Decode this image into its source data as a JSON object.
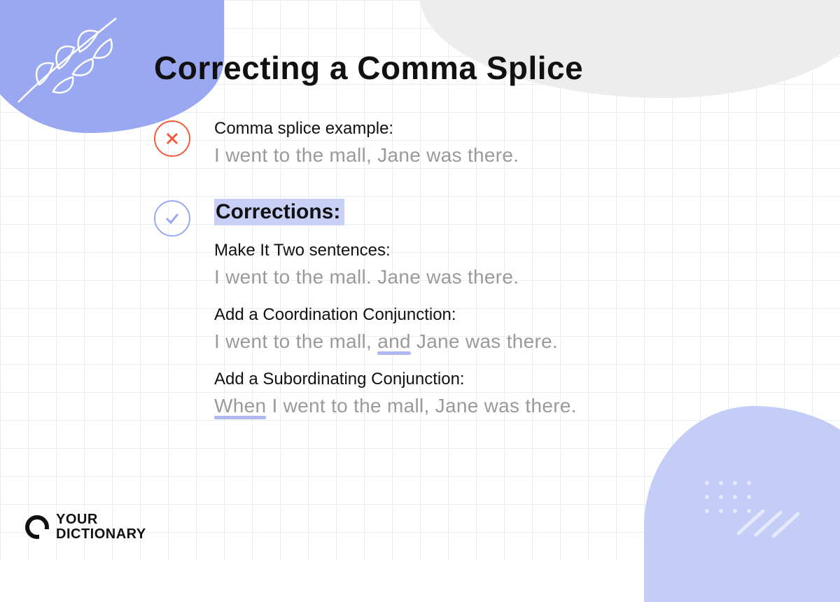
{
  "title": "Correcting a Comma Splice",
  "wrong": {
    "label": "Comma splice example:",
    "example": "I went to the mall, Jane was there."
  },
  "correctionsHeading": "Corrections:",
  "corrections": [
    {
      "label": "Make It Two sentences:",
      "example": "I went to the mall. Jane was there."
    },
    {
      "label": "Add a Coordination Conjunction:",
      "prefix": "I went to the mall, ",
      "underlined": "and",
      "suffix": " Jane was there."
    },
    {
      "label": "Add a Subordinating Conjunction:",
      "underlined": "When",
      "suffix": " I went to the mall, Jane was there."
    }
  ],
  "brand": {
    "line1": "YOUR",
    "line2": "DICTIONARY"
  },
  "colors": {
    "accentBlue": "#9aa8f2",
    "accentBlueLight": "#c4cdf6",
    "highlight": "#c8d0f6",
    "wrong": "#f25a3c",
    "grayText": "#9a9a9a"
  }
}
